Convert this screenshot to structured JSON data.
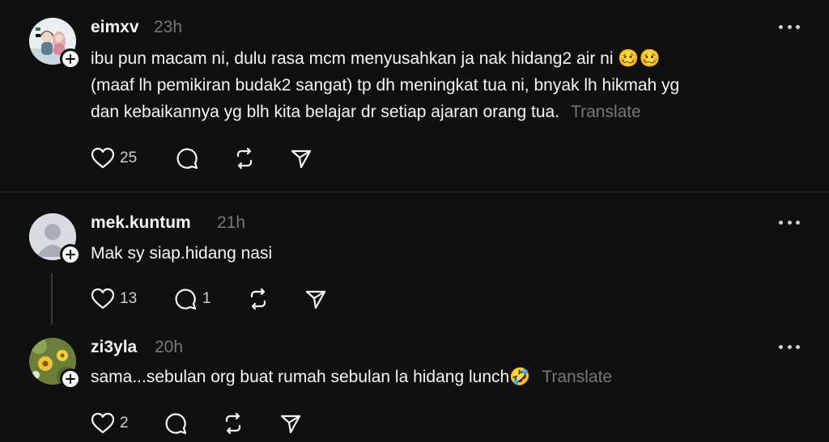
{
  "posts": [
    {
      "username": "eimxv",
      "time": "23h",
      "text_lines": [
        "ibu pun macam ni, dulu rasa mcm menyusahkan ja nak hidang2 air ni 🥴🥴",
        "(maaf lh pemikiran budak2 sangat) tp dh meningkat tua ni, bnyak lh hikmah yg",
        "dan kebaikannya yg blh kita belajar dr setiap ajaran orang tua."
      ],
      "translate_label": "Translate",
      "likes": "25",
      "replies": "",
      "avatar": "couple-cartoon-avatar"
    },
    {
      "username": "mek.kuntum",
      "time": "21h",
      "text_lines": [
        "Mak sy siap.hidang nasi"
      ],
      "likes": "13",
      "replies": "1",
      "avatar": "default-profile-avatar"
    },
    {
      "username": "zi3yla",
      "time": "20h",
      "text_lines": [
        "sama...sebulan org buat rumah sebulan la hidang lunch🤣"
      ],
      "translate_label": "Translate",
      "likes": "2",
      "replies": "",
      "avatar": "flower-avatar"
    }
  ],
  "colors": {
    "background": "#101010",
    "text": "#f3f5f7",
    "muted": "#777777"
  },
  "icons": [
    "heart-icon",
    "comment-icon",
    "repost-icon",
    "share-icon",
    "more-icon",
    "follow-plus-icon"
  ]
}
